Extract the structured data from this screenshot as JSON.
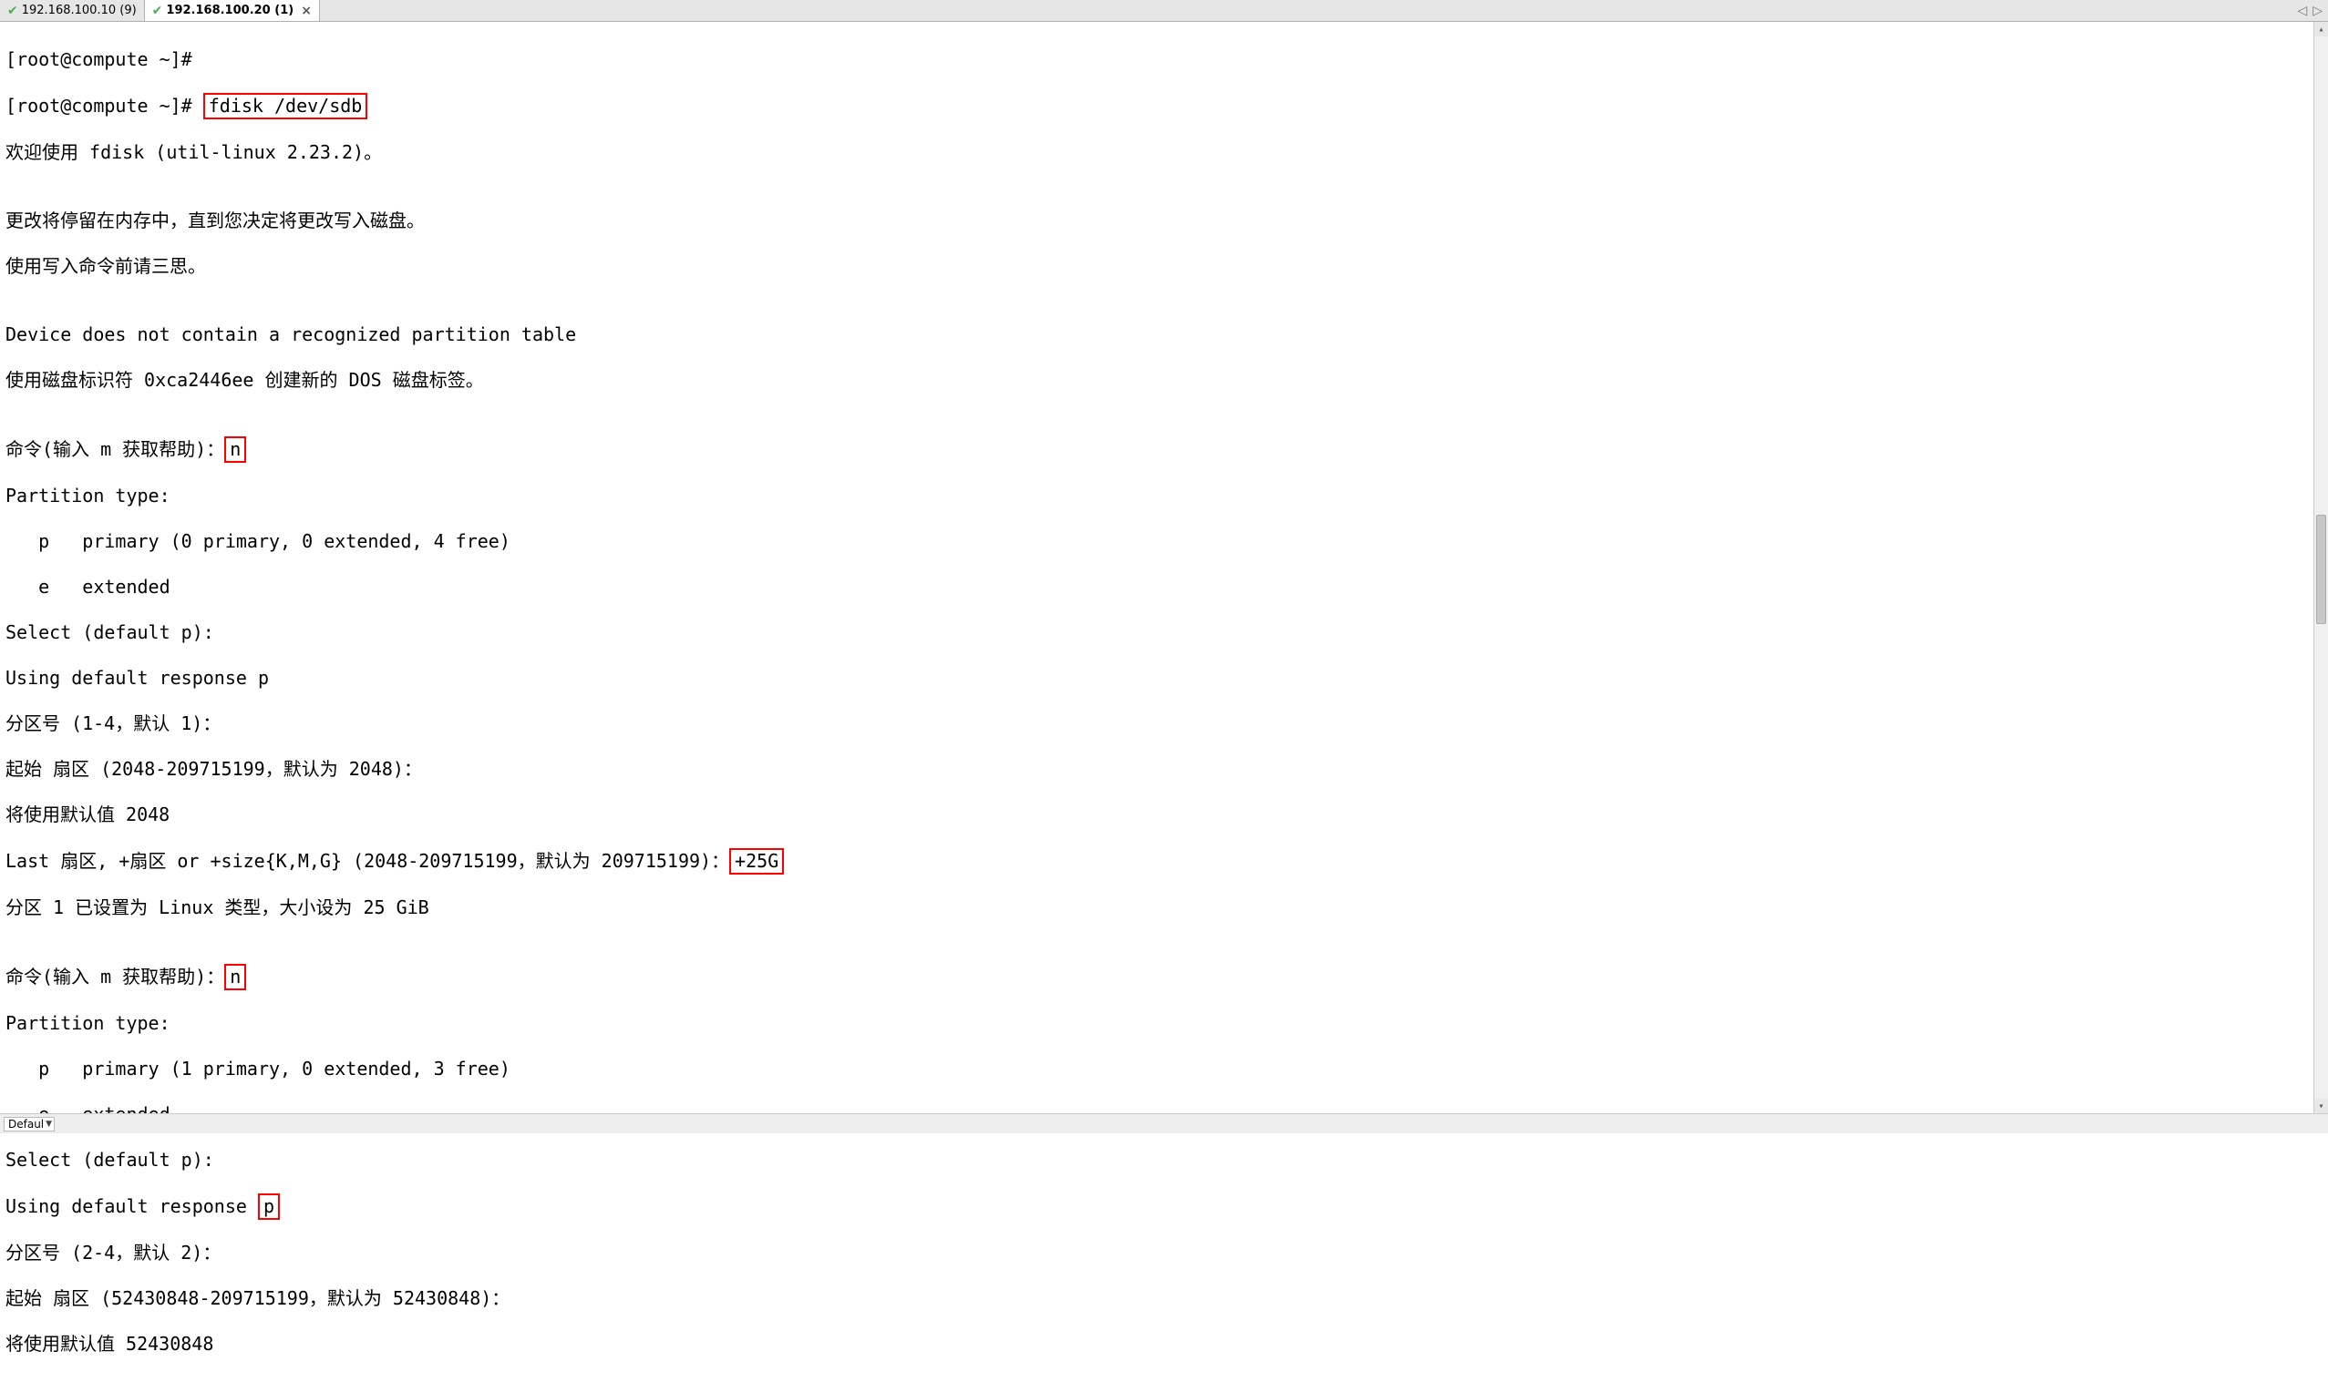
{
  "tabs": [
    {
      "label": "192.168.100.10 (9)",
      "active": false
    },
    {
      "label": "192.168.100.20 (1)",
      "active": true
    }
  ],
  "status": {
    "select_label": "Defaul"
  },
  "term": {
    "l1": "[root@compute ~]#",
    "l2_prompt": "[root@compute ~]# ",
    "l2_cmd": "fdisk /dev/sdb",
    "l3": "欢迎使用 fdisk (util-linux 2.23.2)。",
    "l4": "",
    "l5": "更改将停留在内存中，直到您决定将更改写入磁盘。",
    "l6": "使用写入命令前请三思。",
    "l7": "",
    "l8": "Device does not contain a recognized partition table",
    "l9": "使用磁盘标识符 0xca2446ee 创建新的 DOS 磁盘标签。",
    "l10": "",
    "l11_pre": "命令(输入 m 获取帮助)：",
    "l11_in": "n",
    "l12": "Partition type:",
    "l13": "   p   primary (0 primary, 0 extended, 4 free)",
    "l14": "   e   extended",
    "l15": "Select (default p):",
    "l16": "Using default response p",
    "l17": "分区号 (1-4，默认 1)：",
    "l18": "起始 扇区 (2048-209715199，默认为 2048)：",
    "l19": "将使用默认值 2048",
    "l20_pre": "Last 扇区, +扇区 or +size{K,M,G} (2048-209715199，默认为 209715199)：",
    "l20_in": "+25G",
    "l21": "分区 1 已设置为 Linux 类型，大小设为 25 GiB",
    "l22": "",
    "l23_pre": "命令(输入 m 获取帮助)：",
    "l23_in": "n",
    "l24": "Partition type:",
    "l25": "   p   primary (1 primary, 0 extended, 3 free)",
    "l26": "   e   extended",
    "l27": "Select (default p):",
    "l28_pre": "Using default response ",
    "l28_in": "p",
    "l29": "分区号 (2-4，默认 2)：",
    "l30": "起始 扇区 (52430848-209715199，默认为 52430848)：",
    "l31": "将使用默认值 52430848"
  }
}
